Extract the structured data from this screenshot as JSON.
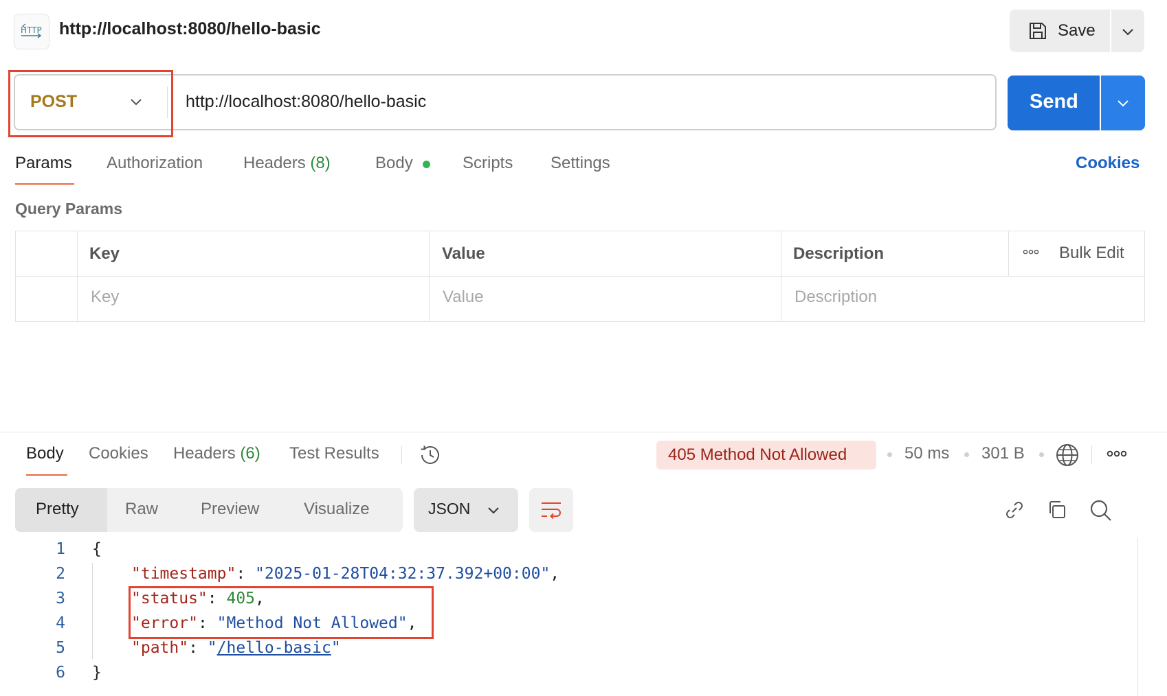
{
  "header": {
    "icon_label": "HTTP",
    "title": "http://localhost:8080/hello-basic",
    "save_label": "Save"
  },
  "request": {
    "method": "POST",
    "url": "http://localhost:8080/hello-basic",
    "send_label": "Send"
  },
  "tabs": {
    "params": "Params",
    "authorization": "Authorization",
    "headers": "Headers",
    "headers_count": "(8)",
    "body": "Body",
    "scripts": "Scripts",
    "settings": "Settings",
    "cookies": "Cookies"
  },
  "query_params": {
    "title": "Query Params",
    "columns": {
      "key": "Key",
      "value": "Value",
      "description": "Description"
    },
    "bulk_edit": "Bulk Edit",
    "placeholders": {
      "key": "Key",
      "value": "Value",
      "description": "Description"
    }
  },
  "response": {
    "tabs": {
      "body": "Body",
      "cookies": "Cookies",
      "headers": "Headers",
      "headers_count": "(6)",
      "test_results": "Test Results"
    },
    "status": "405 Method Not Allowed",
    "time": "50 ms",
    "size": "301 B",
    "view_modes": [
      "Pretty",
      "Raw",
      "Preview",
      "Visualize"
    ],
    "format": "JSON",
    "lines": {
      "l1": "1",
      "l2": "2",
      "l3": "3",
      "l4": "4",
      "l5": "5",
      "l6": "6"
    },
    "json": {
      "open_brace": "{",
      "close_brace": "}",
      "timestamp_key": "\"timestamp\"",
      "timestamp_value": "\"2025-01-28T04:32:37.392+00:00\"",
      "status_key": "\"status\"",
      "status_value": "405",
      "error_key": "\"error\"",
      "error_value": "\"Method Not Allowed\"",
      "path_key": "\"path\"",
      "path_value": "/hello-basic"
    }
  },
  "colors": {
    "accent_orange": "#e86a3d",
    "send_blue": "#1f6fd9",
    "method_post": "#a6781c",
    "error_red": "#9c2418",
    "highlight_box": "#e2442f"
  }
}
